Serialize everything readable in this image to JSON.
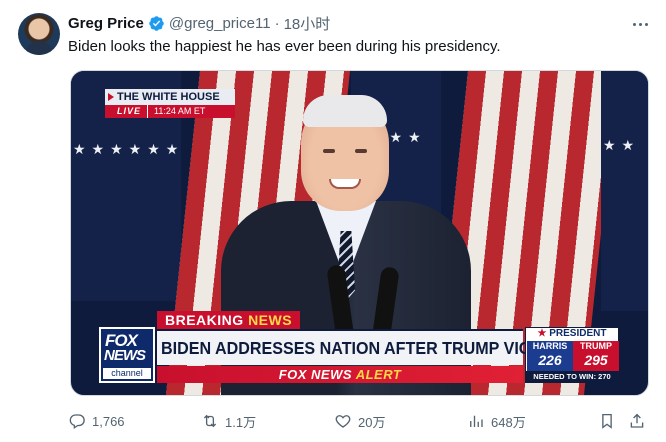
{
  "author": {
    "name": "Greg Price",
    "handle": "@greg_price11",
    "separator": "·",
    "time": "18小时"
  },
  "tweet": {
    "text": "Biden looks the happiest he has ever been during his presidency."
  },
  "media": {
    "bug_title": "THE WHITE HOUSE",
    "bug_live": "LIVE",
    "bug_time": "11:24 AM ET",
    "breaking_word1": "BREAKING",
    "breaking_word2": "NEWS",
    "headline": "BIDEN ADDRESSES NATION AFTER TRUMP VICTORY",
    "alert_word1": "FOX NEWS",
    "alert_word2": "ALERT",
    "logo_line1": "FOX",
    "logo_line2": "NEWS",
    "logo_line3": "channel",
    "race_title": "PRESIDENT",
    "race_star": "★",
    "harris_label": "HARRIS",
    "harris_votes": "226",
    "trump_label": "TRUMP",
    "trump_votes": "295",
    "needed": "NEEDED TO WIN: 270"
  },
  "actions": {
    "replies": "1,766",
    "reposts": "1.1万",
    "likes": "20万",
    "views": "648万"
  },
  "colors": {
    "text": "#0f1419",
    "muted": "#536471",
    "verified": "#1d9bf0",
    "fox_red": "#c8102e",
    "fox_navy": "#0e1b3d"
  },
  "icons": [
    "verified-badge-icon",
    "more-icon",
    "reply-icon",
    "repost-icon",
    "like-icon",
    "views-icon",
    "bookmark-icon",
    "share-icon"
  ]
}
